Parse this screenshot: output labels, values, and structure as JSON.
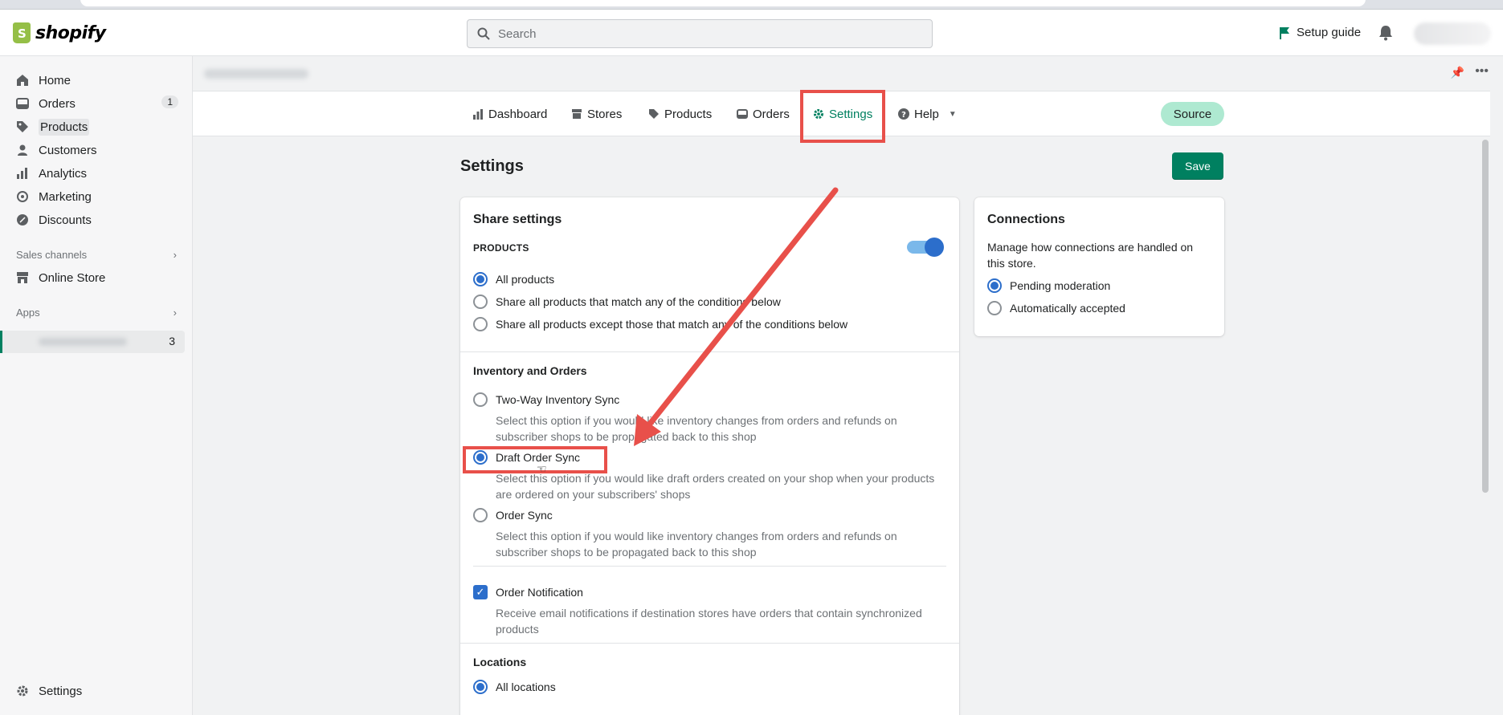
{
  "brand": {
    "name": "shopify"
  },
  "topbar": {
    "search_placeholder": "Search",
    "setup_guide": "Setup guide"
  },
  "sidebar": {
    "items": [
      {
        "label": "Home",
        "icon": "home-icon"
      },
      {
        "label": "Orders",
        "icon": "orders-icon",
        "badge": "1"
      },
      {
        "label": "Products",
        "icon": "tag-icon",
        "active": true
      },
      {
        "label": "Customers",
        "icon": "person-icon"
      },
      {
        "label": "Analytics",
        "icon": "bar-chart-icon"
      },
      {
        "label": "Marketing",
        "icon": "target-icon"
      },
      {
        "label": "Discounts",
        "icon": "discount-icon"
      }
    ],
    "sales_channels_label": "Sales channels",
    "online_store": "Online Store",
    "apps_label": "Apps",
    "app_badge": "3",
    "settings": "Settings"
  },
  "appnav": {
    "tabs": [
      {
        "label": "Dashboard",
        "icon": "chart-icon"
      },
      {
        "label": "Stores",
        "icon": "store-icon"
      },
      {
        "label": "Products",
        "icon": "tag-icon"
      },
      {
        "label": "Orders",
        "icon": "inbox-icon"
      },
      {
        "label": "Settings",
        "icon": "gear-icon",
        "active": true
      },
      {
        "label": "Help",
        "icon": "question-icon"
      }
    ],
    "source_pill": "Source"
  },
  "page": {
    "title": "Settings",
    "save_label": "Save"
  },
  "share_settings": {
    "title": "Share settings",
    "products_heading": "PRODUCTS",
    "products_toggle_on": true,
    "product_options": [
      {
        "label": "All products",
        "selected": true
      },
      {
        "label": "Share all products that match any of the conditions below",
        "selected": false
      },
      {
        "label": "Share all products except those that match any of the conditions below",
        "selected": false
      }
    ],
    "inventory_heading": "Inventory and Orders",
    "inventory_options": [
      {
        "label": "Two-Way Inventory Sync",
        "help": "Select this option if you would like inventory changes from orders and refunds on subscriber shops to be propagated back to this shop",
        "selected": false
      },
      {
        "label": "Draft Order Sync",
        "help": "Select this option if you would like draft orders created on your shop when your products are ordered on your subscribers' shops",
        "selected": true
      },
      {
        "label": "Order Sync",
        "help": "Select this option if you would like inventory changes from orders and refunds on subscriber shops to be propagated back to this shop",
        "selected": false
      }
    ],
    "order_notification": {
      "label": "Order Notification",
      "help": "Receive email notifications if destination stores have orders that contain synchronized products",
      "checked": true
    },
    "locations_heading": "Locations",
    "locations_option": "All locations"
  },
  "connections": {
    "title": "Connections",
    "description": "Manage how connections are handled on this store.",
    "options": [
      {
        "label": "Pending moderation",
        "selected": true
      },
      {
        "label": "Automatically accepted",
        "selected": false
      }
    ]
  },
  "colors": {
    "accent_green": "#008060",
    "radio_blue": "#2c6ecb",
    "highlight_red": "#e8504a",
    "source_pill": "#aee9d1"
  }
}
